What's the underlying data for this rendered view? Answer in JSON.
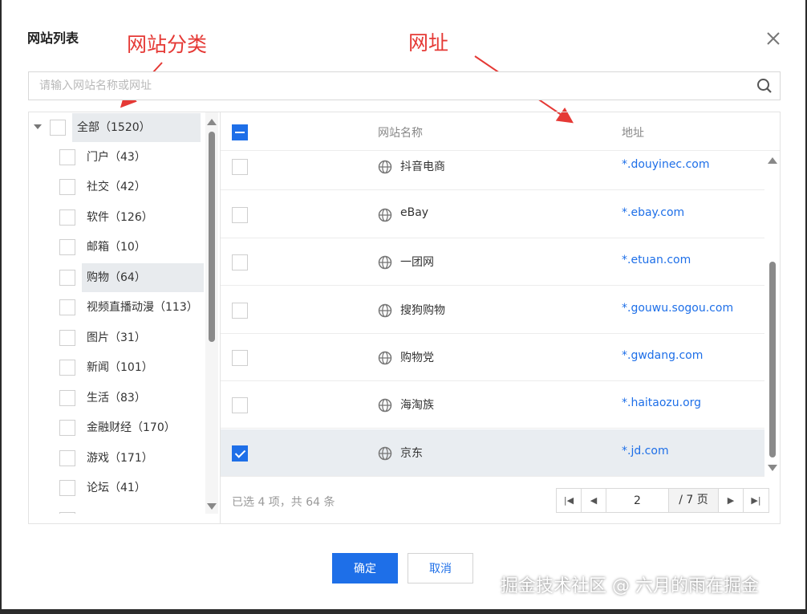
{
  "dialog": {
    "title": "网站列表",
    "search_placeholder": "请输入网站名称或网址",
    "confirm_label": "确定",
    "cancel_label": "取消"
  },
  "annotations": {
    "category_label": "网站分类",
    "url_label": "网址",
    "color": "#e53935"
  },
  "tree": {
    "root": {
      "label": "全部（1520）"
    },
    "items": [
      {
        "label": "门户（43）"
      },
      {
        "label": "社交（42）"
      },
      {
        "label": "软件（126）"
      },
      {
        "label": "邮箱（10）"
      },
      {
        "label": "购物（64）",
        "highlighted": true
      },
      {
        "label": "视频直播动漫（113）"
      },
      {
        "label": "图片（31）"
      },
      {
        "label": "新闻（101）"
      },
      {
        "label": "生活（83）"
      },
      {
        "label": "金融财经（170）"
      },
      {
        "label": "游戏（171）"
      },
      {
        "label": "论坛（41）"
      }
    ]
  },
  "table": {
    "columns": [
      "网站名称",
      "地址"
    ],
    "rows": [
      {
        "name": "抖音电商",
        "address": "*.douyinec.com",
        "checked": false
      },
      {
        "name": "eBay",
        "address": "*.ebay.com",
        "checked": false
      },
      {
        "name": "一团网",
        "address": "*.etuan.com",
        "checked": false
      },
      {
        "name": "搜狗购物",
        "address": "*.gouwu.sogou.com",
        "checked": false
      },
      {
        "name": "购物党",
        "address": "*.gwdang.com",
        "checked": false
      },
      {
        "name": "海淘族",
        "address": "*.haitaozu.org",
        "checked": false
      },
      {
        "name": "京东",
        "address": "*.jd.com",
        "checked": true
      }
    ]
  },
  "footer": {
    "selection_info": "已选 4 项，共 64 条",
    "current_page": "2",
    "total_pages": "/ 7 页"
  },
  "watermark": "掘金技术社区 @ 六月的雨在掘金",
  "colors": {
    "primary": "#1e6fe8",
    "selected_row": "#e9edf1"
  }
}
